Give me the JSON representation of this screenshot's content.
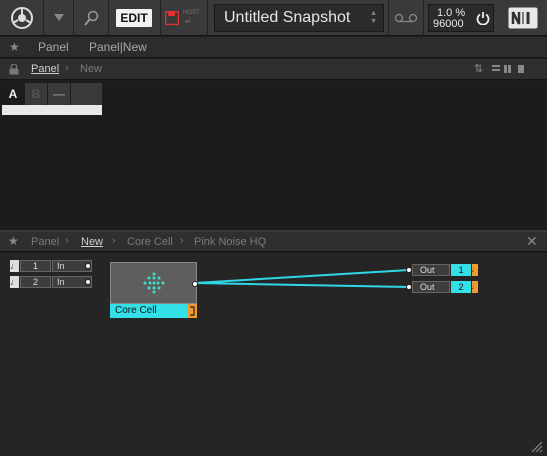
{
  "toolbar": {
    "edit_label": "EDIT",
    "host_label": "HOST",
    "snapshot_name": "Untitled Snapshot",
    "cpu_percent": "1.0 %",
    "sample_rate": "96000"
  },
  "favbar": {
    "items": [
      "Panel",
      "Panel|New"
    ]
  },
  "panel_crumb": {
    "items": [
      "Panel",
      "New"
    ]
  },
  "panel_tabs": [
    "A",
    "B",
    "—"
  ],
  "structure_crumb": {
    "items": [
      "Panel",
      "New",
      "Core Cell",
      "Pink Noise HQ"
    ]
  },
  "structure": {
    "inputs": [
      {
        "num": "1",
        "label": "In"
      },
      {
        "num": "2",
        "label": "In"
      }
    ],
    "core_cell": {
      "label": "Core Cell"
    },
    "outputs": [
      {
        "label": "Out",
        "num": "1"
      },
      {
        "label": "Out",
        "num": "2"
      }
    ]
  },
  "colors": {
    "accent": "#33e0e8",
    "wire": "#2fd6e6",
    "orange": "#f29a2e"
  }
}
